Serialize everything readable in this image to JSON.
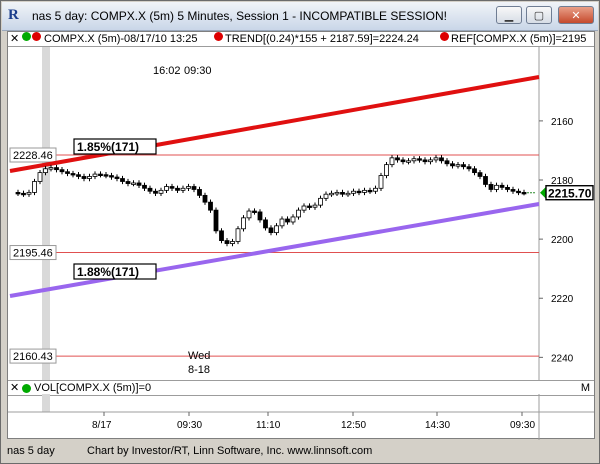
{
  "window": {
    "title": "nas 5 day: COMPX.X (5m) 5 Minutes, Session 1 - INCOMPATIBLE SESSION!",
    "buttons": [
      "minimize",
      "maximize",
      "close"
    ]
  },
  "legend": {
    "symbol": "COMPX.X (5m)-08/17/10 13:25",
    "trend": "TREND[(0.24)*155 + 2187.59]=2224.24",
    "ref": "REF[COMPX.X (5m)]=2195"
  },
  "chart": {
    "time_labels": [
      "16:02",
      "09:30"
    ],
    "day_label": [
      "Wed",
      "8-18"
    ],
    "y_ticks": [
      "2240",
      "2220",
      "2200",
      "2180",
      "2160"
    ],
    "x_ticks": [
      "8/17",
      "09:30",
      "11:10",
      "12:50",
      "14:30",
      "09:30"
    ],
    "ref_levels": [
      "2228.46",
      "2195.46",
      "2160.43"
    ],
    "channel_labels": [
      "1.85%(171)",
      "1.88%(171)"
    ],
    "last_price": "2215.70",
    "trend_color": "#e01010",
    "support_color": "#9966ee",
    "ref_color": "#e05050",
    "last_price_color": "#00aa00"
  },
  "chart_data": {
    "type": "candlestick",
    "ylim": [
      2152,
      2265
    ],
    "y_ticks": [
      2160,
      2180,
      2200,
      2220,
      2240
    ],
    "reference_lines": [
      2228.46,
      2195.46,
      2160.43
    ],
    "last_price": 2215.7,
    "closes": [
      2215.5,
      2215.2,
      2215.8,
      2219.5,
      2222.5,
      2223.8,
      2224.2,
      2223.5,
      2222.8,
      2222.2,
      2221.8,
      2221.2,
      2220.5,
      2221.2,
      2222.0,
      2221.8,
      2221.5,
      2221.0,
      2220.5,
      2219.5,
      2218.8,
      2219.0,
      2218.2,
      2217.2,
      2216.2,
      2215.5,
      2216.5,
      2217.8,
      2217.2,
      2216.5,
      2217.2,
      2217.8,
      2216.8,
      2214.8,
      2212.5,
      2209.8,
      2202.8,
      2199.5,
      2198.5,
      2199.2,
      2203.5,
      2207.2,
      2209.5,
      2209.2,
      2206.5,
      2203.8,
      2202.2,
      2204.5,
      2206.8,
      2205.8,
      2207.5,
      2209.8,
      2211.2,
      2210.8,
      2211.5,
      2213.8,
      2215.2,
      2215.5,
      2215.8,
      2215.2,
      2215.5,
      2216.2,
      2215.8,
      2216.5,
      2216.2,
      2217.2,
      2221.5,
      2225.2,
      2227.5,
      2226.8,
      2226.2,
      2226.5,
      2227.2,
      2226.8,
      2226.2,
      2226.8,
      2227.5,
      2226.5,
      2225.5,
      2224.8,
      2225.2,
      2224.5,
      2223.8,
      2222.5,
      2221.2,
      2218.5,
      2216.8,
      2218.2,
      2217.5,
      2216.8,
      2216.2,
      2215.8,
      2215.7
    ]
  },
  "volume": {
    "label": "VOL[COMPX.X (5m)]=0"
  },
  "status": {
    "left": "nas 5 day",
    "credit": "Chart by Investor/RT, Linn Software, Inc. www.linnsoft.com"
  }
}
